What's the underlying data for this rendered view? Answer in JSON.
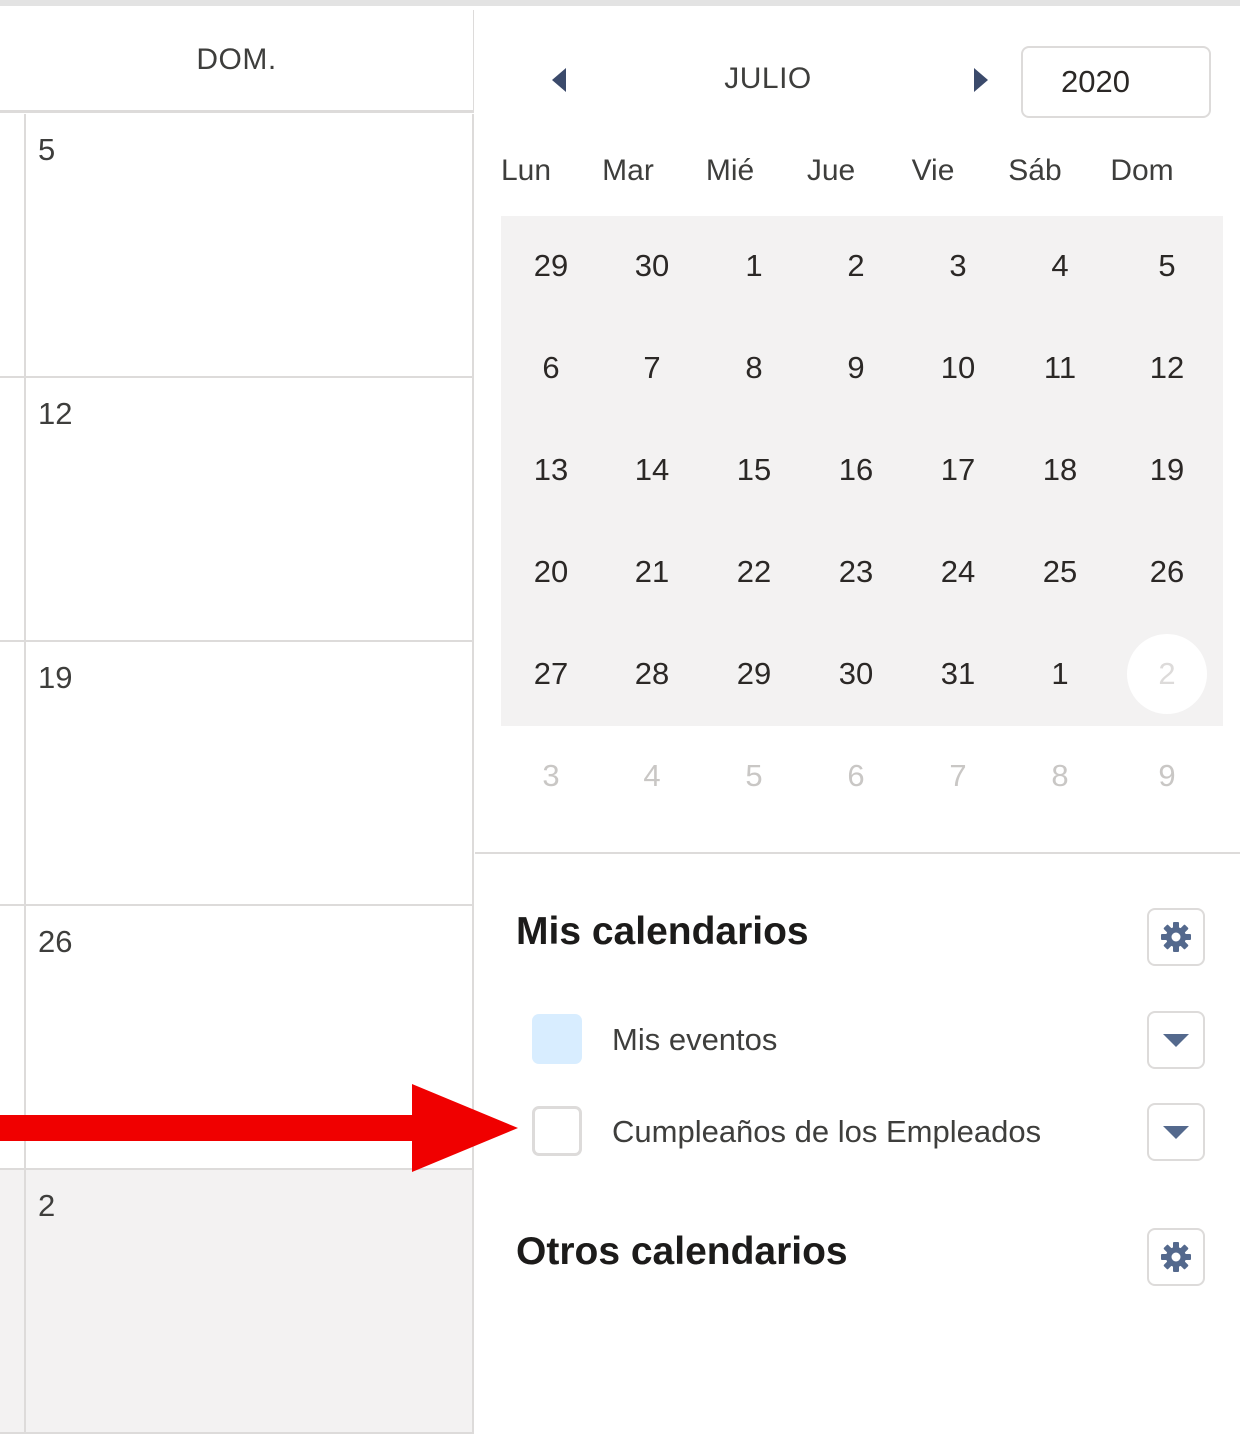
{
  "week_column": {
    "header": "DOM.",
    "days": [
      "5",
      "12",
      "19",
      "26",
      "2"
    ]
  },
  "mini_calendar": {
    "month": "JULIO",
    "year": "2020",
    "prev_icon": "triangle-left-icon",
    "next_icon": "triangle-right-icon",
    "weekdays": [
      "Lun",
      "Mar",
      "Mié",
      "Jue",
      "Vie",
      "Sáb",
      "Dom"
    ],
    "rows": [
      [
        "29",
        "30",
        "1",
        "2",
        "3",
        "4",
        "5"
      ],
      [
        "6",
        "7",
        "8",
        "9",
        "10",
        "11",
        "12"
      ],
      [
        "13",
        "14",
        "15",
        "16",
        "17",
        "18",
        "19"
      ],
      [
        "20",
        "21",
        "22",
        "23",
        "24",
        "25",
        "26"
      ],
      [
        "27",
        "28",
        "29",
        "30",
        "31",
        "1",
        "2"
      ],
      [
        "3",
        "4",
        "5",
        "6",
        "7",
        "8",
        "9"
      ]
    ]
  },
  "my_calendars": {
    "title": "Mis calendarios",
    "settings_icon": "gear-icon",
    "items": [
      {
        "label": "Mis eventos",
        "checked": true,
        "color": "#d8edff",
        "menu_icon": "chevron-down-icon"
      },
      {
        "label": "Cumpleaños de los Empleados",
        "checked": false,
        "color": "#ffffff",
        "menu_icon": "chevron-down-icon"
      }
    ]
  },
  "other_calendars": {
    "title": "Otros calendarios",
    "settings_icon": "gear-icon"
  },
  "colors": {
    "annotation_arrow": "#f00000",
    "muted_background": "#f3f2f2",
    "nav_arrow": "#3b4a6b"
  }
}
